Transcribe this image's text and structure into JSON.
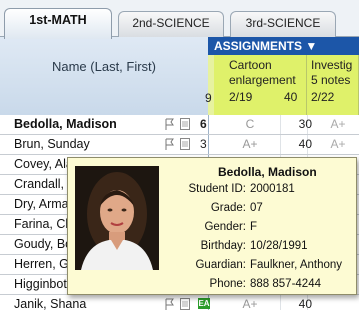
{
  "tabs": [
    {
      "label": "1st-MATH",
      "active": true
    },
    {
      "label": "2nd-SCIENCE",
      "active": false
    },
    {
      "label": "3rd-SCIENCE",
      "active": false
    }
  ],
  "name_column_header": "Name (Last, First)",
  "assignments_header": "ASSIGNMENTS ▼",
  "assignments": [
    {
      "title_lines": [
        "Cartoon",
        "enlargement"
      ],
      "date": "2/19",
      "points": "40"
    },
    {
      "title_lines": [
        "Investig",
        "5 notes"
      ],
      "date": "2/22",
      "points": ""
    }
  ],
  "assignment_stub_date_digit": "9",
  "students": [
    {
      "name": "Bedolla, Madison",
      "bold": true,
      "flag": "flag-icon",
      "note": "note-icon",
      "stub": "6",
      "score1": "C",
      "score2": "30",
      "score3": "A+"
    },
    {
      "name": "Brun, Sunday",
      "bold": false,
      "flag": "flag-icon",
      "note": "note-icon",
      "stub": "3",
      "score1": "A+",
      "score2": "40",
      "score3": "A+"
    },
    {
      "name": "Covey, Alan",
      "bold": false
    },
    {
      "name": "Crandall, Elis",
      "bold": false
    },
    {
      "name": "Dry, Armand",
      "bold": false
    },
    {
      "name": "Farina, Clayt",
      "bold": false
    },
    {
      "name": "Goudy, Bong",
      "bold": false
    },
    {
      "name": "Herren, Guill",
      "bold": false
    },
    {
      "name": "Higginbothar",
      "bold": false
    },
    {
      "name": "Janik, Shana",
      "bold": false,
      "flag": "flag-icon",
      "note": "note-icon",
      "badge": "EA",
      "score1": "A+",
      "score2": "40",
      "score3": ""
    }
  ],
  "popup": {
    "name": "Bedolla, Madison",
    "fields": [
      {
        "label": "Student ID:",
        "value": "2000181"
      },
      {
        "label": "Grade:",
        "value": "07"
      },
      {
        "label": "Gender:",
        "value": "F"
      },
      {
        "label": "Birthday:",
        "value": "10/28/1991"
      },
      {
        "label": "Guardian:",
        "value": "Faulkner, Anthony"
      },
      {
        "label": "Phone:",
        "value": "888 857-4244"
      }
    ]
  },
  "colors": {
    "assign_header": "#1c56a8",
    "assign_column": "#dff16a",
    "popup_bg": "#fdfbd3",
    "tabbar_bg": "#eef2f6"
  }
}
